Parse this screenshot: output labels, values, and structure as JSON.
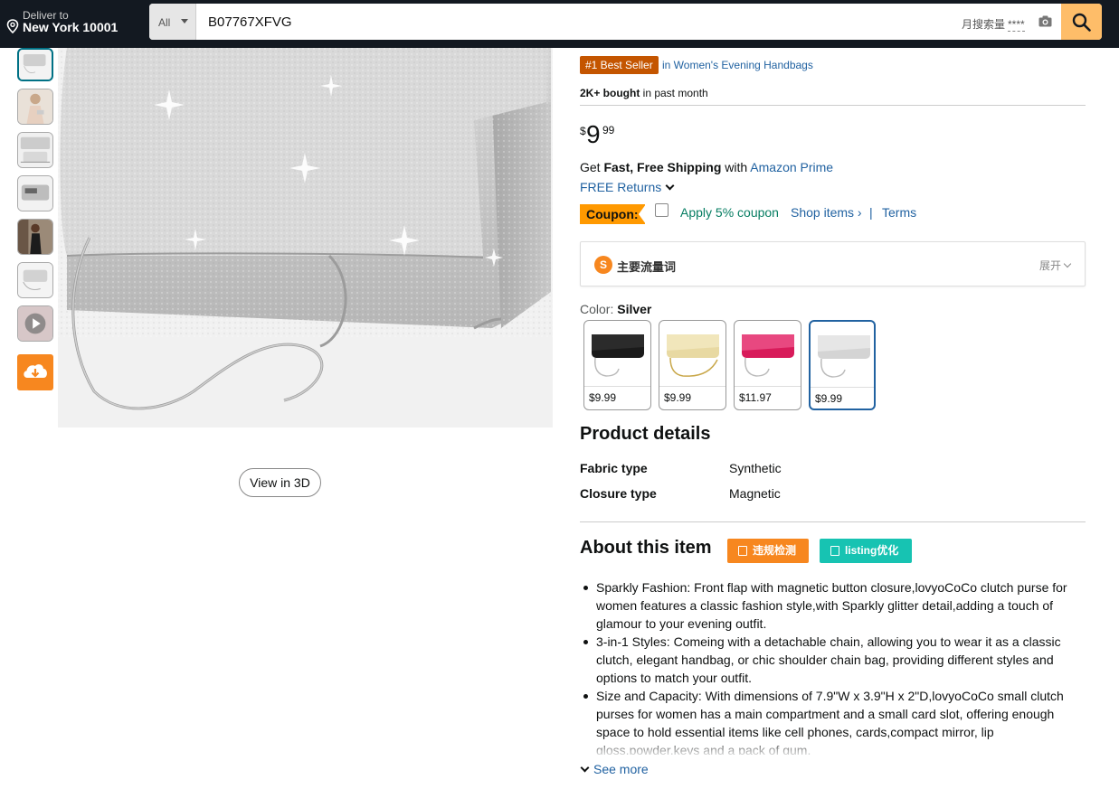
{
  "header": {
    "deliver_line1": "Deliver to",
    "deliver_line2": "New York 10001",
    "search_category": "All",
    "search_value": "B07767XFVG",
    "monthly_label": "月搜索量",
    "monthly_value": "****"
  },
  "gallery": {
    "thumbnail_count": 7,
    "active_thumbnail": 1,
    "view3d_label": "View in 3D"
  },
  "product": {
    "bestseller_badge": "#1 Best Seller",
    "bestseller_category": "in Women's Evening Handbags",
    "bought_bold": "2K+ bought",
    "bought_rest": " in past month",
    "price_symbol": "$",
    "price_whole": "9",
    "price_fraction": "99",
    "shipping": {
      "prefix": "Get ",
      "bold": "Fast, Free Shipping",
      "middle": " with ",
      "link": "Amazon Prime"
    },
    "returns_label": "FREE Returns",
    "coupon": {
      "badge": "Coupon:",
      "apply": "Apply 5% coupon",
      "shop": "Shop items ›",
      "separator": "|",
      "terms": "Terms"
    },
    "traffic": {
      "logo": "S",
      "title": "主要流量词",
      "expand": "展开"
    },
    "color": {
      "label": "Color: ",
      "selected": "Silver",
      "options": [
        {
          "price": "$9.99",
          "swatch": "#1a1a1a"
        },
        {
          "price": "$9.99",
          "swatch": "#e6d49a"
        },
        {
          "price": "$11.97",
          "swatch": "#d81b5a"
        },
        {
          "price": "$9.99",
          "swatch": "#d9d9d9"
        }
      ]
    },
    "details": {
      "title": "Product details",
      "rows": [
        {
          "key": "Fabric type",
          "value": "Synthetic"
        },
        {
          "key": "Closure type",
          "value": "Magnetic"
        }
      ]
    },
    "about": {
      "title": "About this item",
      "btn_compliance": "违规检测",
      "btn_listing": "listing优化",
      "bullets": [
        "Sparkly Fashion: Front flap with magnetic button closure,lovyoCoCo clutch purse for women features a classic fashion style,with Sparkly glitter detail,adding a touch of glamour to your evening outfit.",
        "3-in-1 Styles: Comeing with a detachable chain, allowing you to wear it as a classic clutch, elegant handbag, or chic shoulder chain bag, providing different styles and options to match your outfit.",
        "Size and Capacity: With dimensions of 7.9\"W x 3.9\"H x 2\"D,lovyoCoCo small clutch purses for women has a main compartment and a small card slot, offering enough space to hold essential items like cell phones, cards,compact mirror, lip gloss,powder,keys and a pack of gum."
      ],
      "see_more": "See more"
    }
  },
  "colors": {
    "header_bg": "#131921",
    "search_button": "#febd69",
    "link": "#2162a1",
    "bestseller": "#c45500",
    "coupon": "#ff9900",
    "coupon_text": "#067d62",
    "orange_btn": "#f7871f",
    "teal_btn": "#17c3b2"
  }
}
